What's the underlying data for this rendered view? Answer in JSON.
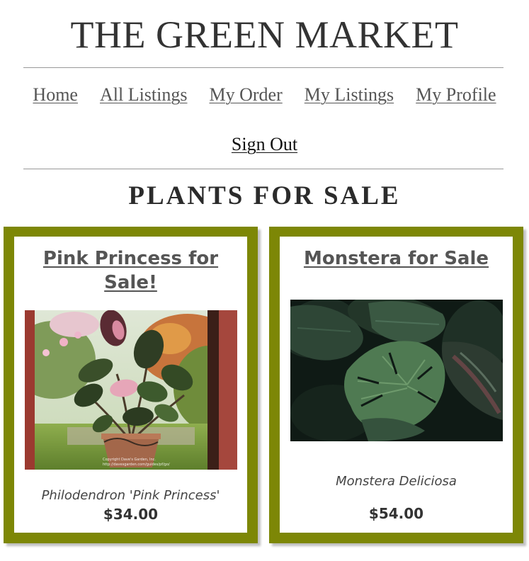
{
  "site": {
    "title": "THE GREEN MARKET"
  },
  "nav": {
    "items": [
      "Home",
      "All Listings",
      "My Order",
      "My Listings",
      "My Profile"
    ],
    "sign_out": "Sign Out"
  },
  "page": {
    "heading": "PLANTS FOR SALE"
  },
  "listings": [
    {
      "title": "Pink Princess for Sale!",
      "scientific_name": "Philodendron 'Pink Princess'",
      "price": "$34.00",
      "photo_caption": "Copyright Dave's Garden, Inc. http://davesgarden.com/guides/pf/go/"
    },
    {
      "title": "Monstera for Sale",
      "scientific_name": "Monstera Deliciosa",
      "price": "$54.00"
    }
  ],
  "colors": {
    "card_frame": "#7d8706",
    "text": "#333333",
    "link": "#555555"
  }
}
